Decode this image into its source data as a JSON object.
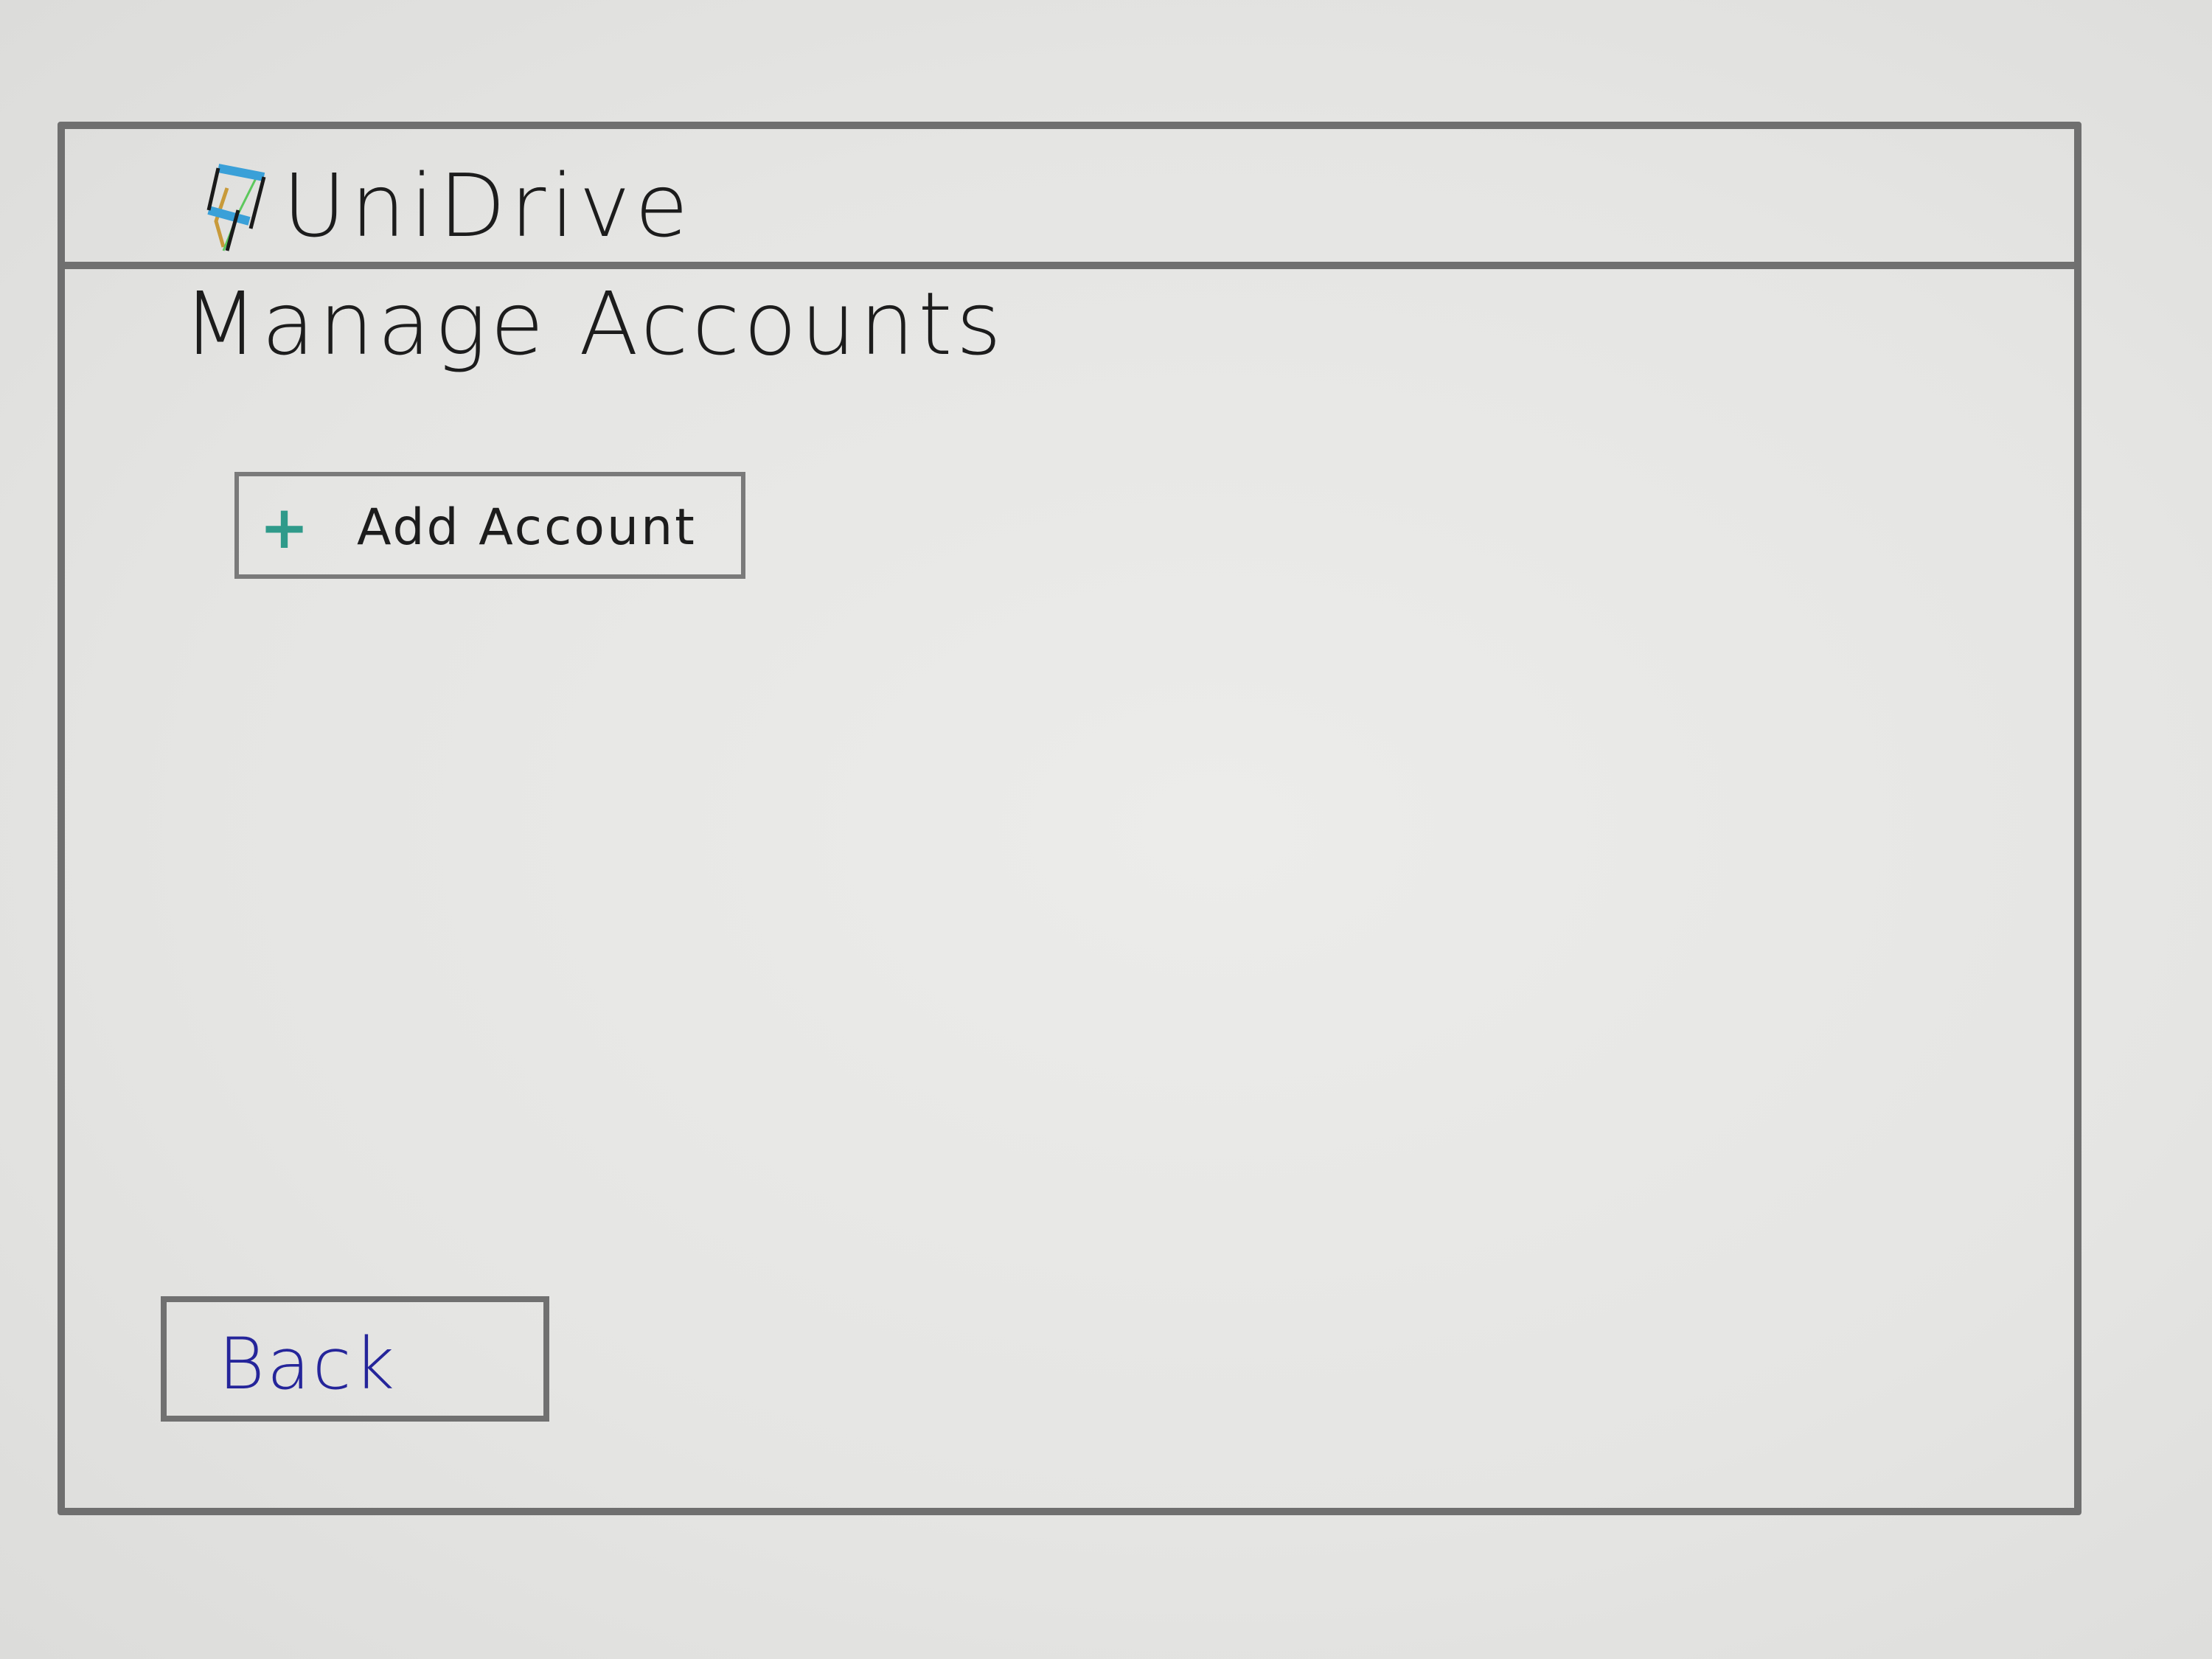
{
  "header": {
    "app_title": "UniDrive",
    "logo_icon": "cube-logo-icon"
  },
  "main": {
    "page_title": "Manage Accounts",
    "add_account_label": "Add Account",
    "add_icon": "plus-icon",
    "back_label": "Back"
  },
  "colors": {
    "frame": "#6f6f6f",
    "plus": "#2f9a8a",
    "back_text": "#25259a",
    "logo_blue": "#3aa0d8",
    "logo_gold": "#c89a3a",
    "logo_green": "#5cc85c"
  }
}
